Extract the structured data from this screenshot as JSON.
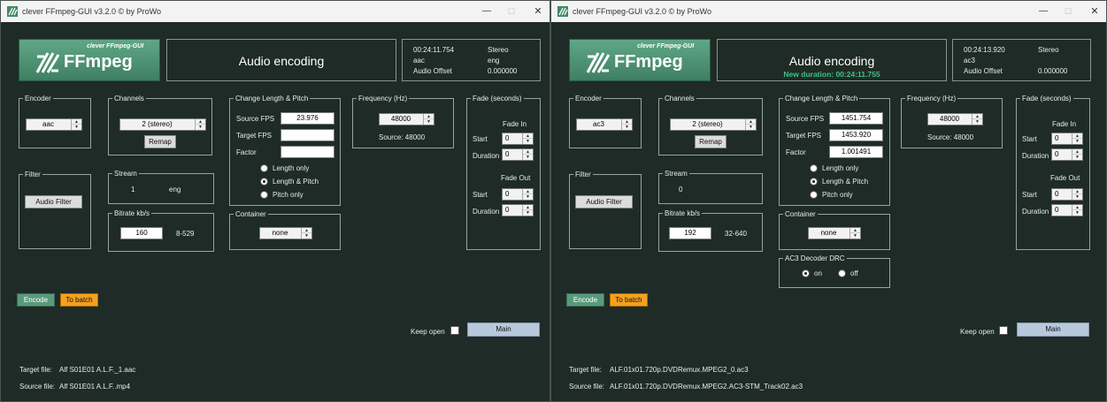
{
  "windows": [
    {
      "title": "clever FFmpeg-GUI v3.2.0   © by ProWo",
      "logo": {
        "small": "clever FFmpeg-GUI",
        "big": "FFmpeg"
      },
      "header": {
        "title": "Audio encoding",
        "new_duration": ""
      },
      "info": {
        "duration": "00:24:11.754",
        "codec": "aac",
        "audio_offset_label": "Audio Offset",
        "channels_label": "Stereo",
        "language": "eng",
        "offset_value": "0.000000"
      },
      "encoder": {
        "label": "Encoder",
        "value": "aac"
      },
      "channels": {
        "label": "Channels",
        "value": "2 (stereo)",
        "remap": "Remap"
      },
      "filter": {
        "label": "Filter",
        "button": "Audio Filter"
      },
      "stream": {
        "label": "Stream",
        "index": "1",
        "language": "eng"
      },
      "bitrate": {
        "label": "Bitrate kb/s",
        "value": "160",
        "range": "8-529"
      },
      "change": {
        "label": "Change Length & Pitch",
        "source_fps_label": "Source FPS",
        "source_fps": "23.976",
        "target_fps_label": "Target FPS",
        "target_fps": "",
        "factor_label": "Factor",
        "factor": "",
        "opt1": "Length only",
        "opt2": "Length & Pitch",
        "opt3": "Pitch only"
      },
      "container": {
        "label": "Container",
        "value": "none"
      },
      "frequency": {
        "label": "Frequency (Hz)",
        "value": "48000",
        "source": "Source: 48000"
      },
      "fade": {
        "label": "Fade (seconds)",
        "fade_in": "Fade In",
        "fade_out": "Fade Out",
        "start": "Start",
        "duration": "Duration",
        "in_start": "0",
        "in_duration": "0",
        "out_start": "0",
        "out_duration": "0"
      },
      "ac3": null,
      "actions": {
        "encode": "Encode",
        "batch": "To batch",
        "keep_open": "Keep open",
        "main": "Main"
      },
      "files": {
        "target_label": "Target file:",
        "target": "Alf S01E01 A.L.F._1.aac",
        "source_label": "Source file:",
        "source": "Alf S01E01 A.L.F..mp4"
      }
    },
    {
      "title": "clever FFmpeg-GUI v3.2.0   © by ProWo",
      "logo": {
        "small": "clever FFmpeg-GUI",
        "big": "FFmpeg"
      },
      "header": {
        "title": "Audio encoding",
        "new_duration": "New duration: 00:24:11.755"
      },
      "info": {
        "duration": "00:24:13.920",
        "codec": "ac3",
        "audio_offset_label": "Audio Offset",
        "channels_label": "Stereo",
        "language": "",
        "offset_value": "0.000000"
      },
      "encoder": {
        "label": "Encoder",
        "value": "ac3"
      },
      "channels": {
        "label": "Channels",
        "value": "2 (stereo)",
        "remap": "Remap"
      },
      "filter": {
        "label": "Filter",
        "button": "Audio Filter"
      },
      "stream": {
        "label": "Stream",
        "index": "0",
        "language": ""
      },
      "bitrate": {
        "label": "Bitrate kb/s",
        "value": "192",
        "range": "32-640"
      },
      "change": {
        "label": "Change Length & Pitch",
        "source_fps_label": "Source FPS",
        "source_fps": "1451.754",
        "target_fps_label": "Target FPS",
        "target_fps": "1453.920",
        "factor_label": "Factor",
        "factor": "1.001491",
        "opt1": "Length only",
        "opt2": "Length & Pitch",
        "opt3": "Pitch only"
      },
      "container": {
        "label": "Container",
        "value": "none"
      },
      "frequency": {
        "label": "Frequency (Hz)",
        "value": "48000",
        "source": "Source: 48000"
      },
      "fade": {
        "label": "Fade (seconds)",
        "fade_in": "Fade In",
        "fade_out": "Fade Out",
        "start": "Start",
        "duration": "Duration",
        "in_start": "0",
        "in_duration": "0",
        "out_start": "0",
        "out_duration": "0"
      },
      "ac3": {
        "label": "AC3 Decoder DRC",
        "on": "on",
        "off": "off"
      },
      "actions": {
        "encode": "Encode",
        "batch": "To batch",
        "keep_open": "Keep open",
        "main": "Main"
      },
      "files": {
        "target_label": "Target file:",
        "target": "ALF.01x01.720p.DVDRemux.MPEG2_0.ac3",
        "source_label": "Source file:",
        "source": "ALF.01x01.720p.DVDRemux.MPEG2.AC3-STM_Track02.ac3"
      }
    }
  ],
  "colors": {
    "background": "#1e2b26",
    "accent_green": "#5a9a7c",
    "batch_orange": "#f5a020",
    "new_duration": "#3fc08a",
    "main_button": "#b8c9dd"
  },
  "icons": [
    "app-logo-icon",
    "minimize-icon",
    "maximize-icon",
    "close-icon",
    "spin-arrows-icon"
  ]
}
